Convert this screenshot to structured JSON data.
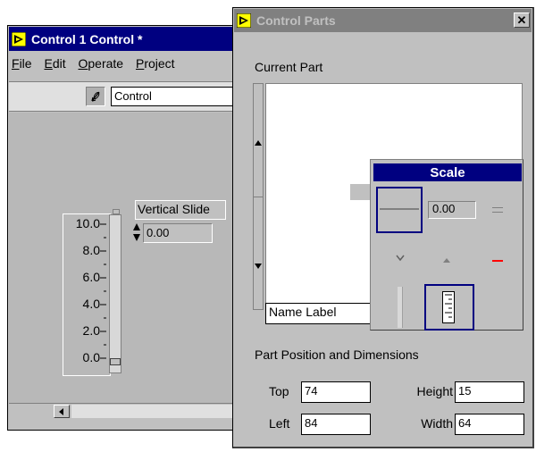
{
  "window1": {
    "title": "Control 1 Control *",
    "menu": [
      {
        "label": "File",
        "ul": "F",
        "rest": "ile"
      },
      {
        "label": "Edit",
        "ul": "E",
        "rest": "dit"
      },
      {
        "label": "Operate",
        "ul": "O",
        "rest": "perate"
      },
      {
        "label": "Project",
        "ul": "P",
        "rest": "roject"
      }
    ],
    "toolbar": {
      "mode_value": "Control"
    },
    "slide": {
      "label": "Vertical Slide",
      "digital_value": "0.00",
      "scale": [
        "10.0",
        "8.0",
        "6.0",
        "4.0",
        "2.0",
        "0.0"
      ],
      "level": 0.0
    }
  },
  "window2": {
    "title": "Control Parts",
    "close_glyph": "✕",
    "current_part_label": "Current Part",
    "part_name": "Name Label",
    "section_label": "Part Position and Dimensions",
    "fields": {
      "top_label": "Top",
      "top_value": "74",
      "left_label": "Left",
      "left_value": "84",
      "height_label": "Height",
      "height_value": "15",
      "width_label": "Width",
      "width_value": "64"
    }
  },
  "palette": {
    "title": "Scale",
    "digital_value": "0.00"
  },
  "colors": {
    "face": "#c0c0c0",
    "panel": "#b8b8b8",
    "title_active": "#000080",
    "title_inactive": "#808080",
    "marker_red": "#ff0000"
  }
}
